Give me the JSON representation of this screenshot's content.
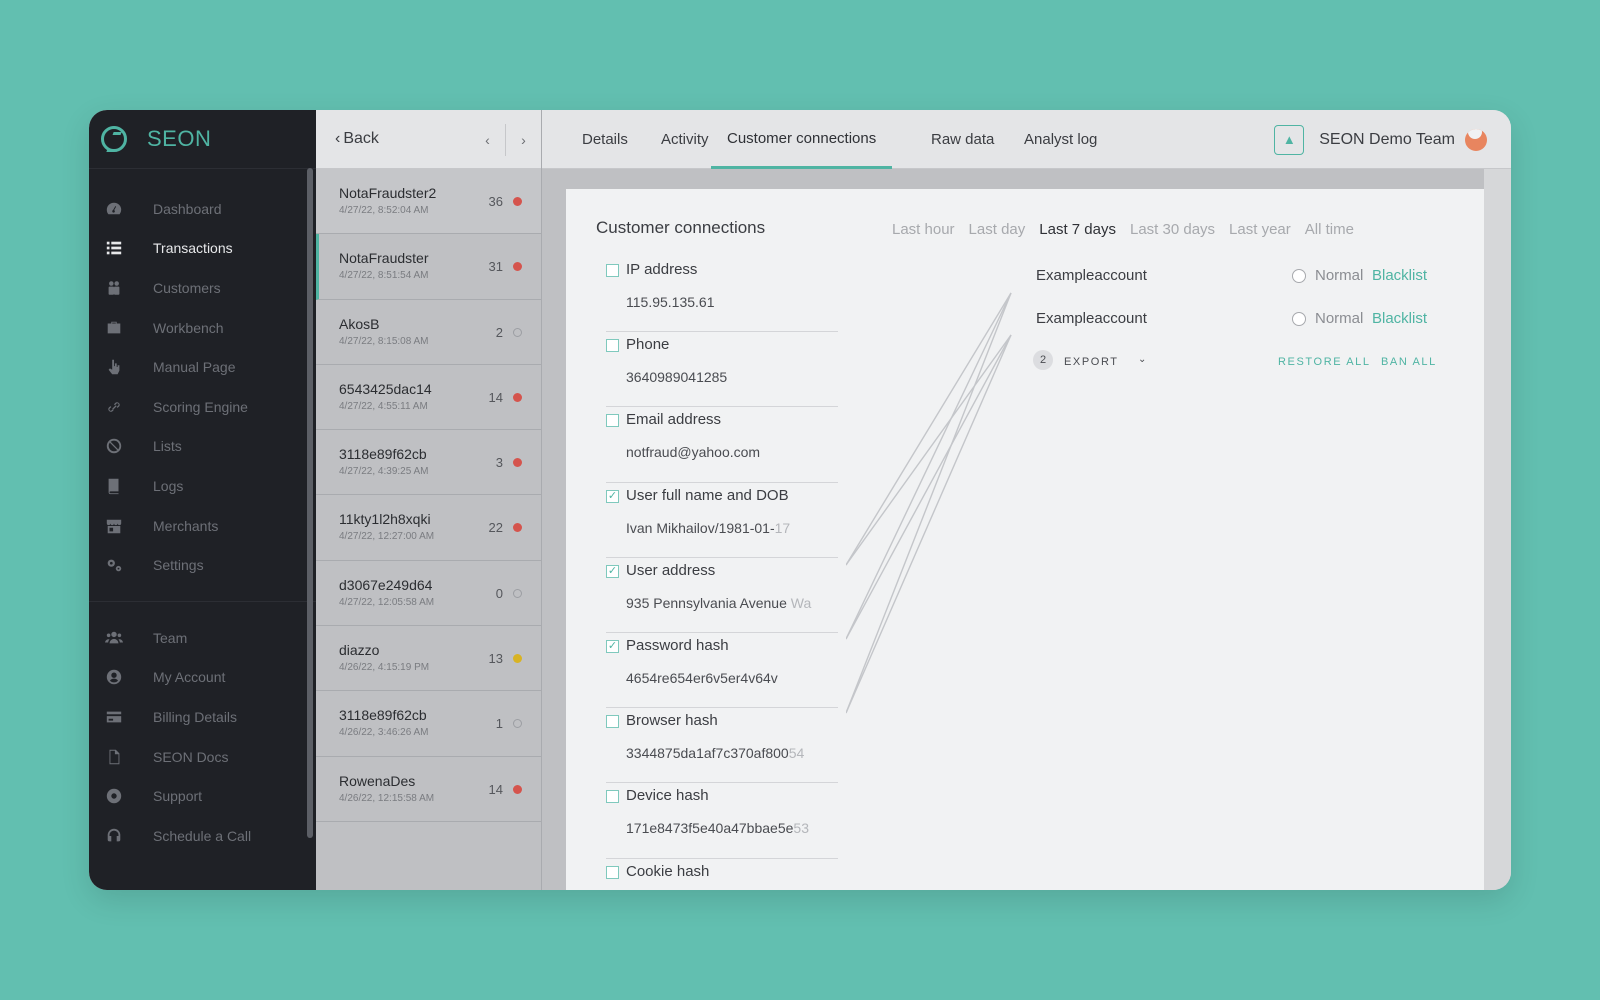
{
  "brand": {
    "name": "SEON"
  },
  "sidebar": {
    "items": [
      {
        "label": "Dashboard",
        "icon": "dashboard-icon",
        "active": false
      },
      {
        "label": "Transactions",
        "icon": "list-icon",
        "active": true
      },
      {
        "label": "Customers",
        "icon": "customers-icon",
        "active": false
      },
      {
        "label": "Workbench",
        "icon": "briefcase-icon",
        "active": false
      },
      {
        "label": "Manual Page",
        "icon": "hand-pointer-icon",
        "active": false
      },
      {
        "label": "Scoring Engine",
        "icon": "link-icon",
        "active": false
      },
      {
        "label": "Lists",
        "icon": "ban-icon",
        "active": false
      },
      {
        "label": "Logs",
        "icon": "book-icon",
        "active": false
      },
      {
        "label": "Merchants",
        "icon": "store-icon",
        "active": false
      },
      {
        "label": "Settings",
        "icon": "gears-icon",
        "active": false
      }
    ],
    "bottom_items": [
      {
        "label": "Team",
        "icon": "team-icon"
      },
      {
        "label": "My Account",
        "icon": "user-circle-icon"
      },
      {
        "label": "Billing Details",
        "icon": "credit-card-icon"
      },
      {
        "label": "SEON Docs",
        "icon": "document-icon"
      },
      {
        "label": "Support",
        "icon": "lifebuoy-icon"
      },
      {
        "label": "Schedule a Call",
        "icon": "headset-icon"
      }
    ]
  },
  "list_panel": {
    "back_label": "Back",
    "prev_icon": "‹",
    "next_icon": "›",
    "rows": [
      {
        "name": "NotaFraudster2",
        "date": "4/27/22, 8:52:04 AM",
        "score": "36",
        "status": "red"
      },
      {
        "name": "NotaFraudster",
        "date": "4/27/22, 8:51:54 AM",
        "score": "31",
        "status": "red"
      },
      {
        "name": "AkosB",
        "date": "4/27/22, 8:15:08 AM",
        "score": "2",
        "status": "empty"
      },
      {
        "name": "6543425dac14",
        "date": "4/27/22, 4:55:11 AM",
        "score": "14",
        "status": "red"
      },
      {
        "name": "3118e89f62cb",
        "date": "4/27/22, 4:39:25 AM",
        "score": "3",
        "status": "red"
      },
      {
        "name": "11kty1l2h8xqki",
        "date": "4/27/22, 12:27:00 AM",
        "score": "22",
        "status": "red"
      },
      {
        "name": "d3067e249d64",
        "date": "4/27/22, 12:05:58 AM",
        "score": "0",
        "status": "empty"
      },
      {
        "name": "diazzo",
        "date": "4/26/22, 4:15:19 PM",
        "score": "13",
        "status": "yellow"
      },
      {
        "name": "3118e89f62cb",
        "date": "4/26/22, 3:46:26 AM",
        "score": "1",
        "status": "empty"
      },
      {
        "name": "RowenaDes",
        "date": "4/26/22, 12:15:58 AM",
        "score": "14",
        "status": "red"
      }
    ]
  },
  "tabs": [
    "Details",
    "Activity",
    "Customer connections",
    "Raw data",
    "Analyst log"
  ],
  "active_tab": "Customer connections",
  "team": {
    "name": "SEON Demo Team",
    "badge_icon": "graduation-cap-icon"
  },
  "card": {
    "title": "Customer connections",
    "time_filters": [
      "Last hour",
      "Last day",
      "Last 7 days",
      "Last 30 days",
      "Last year",
      "All time"
    ],
    "active_filter": "Last 7 days",
    "connections": [
      {
        "label": "IP address",
        "value": "115.95.135.61",
        "value_fade": "",
        "checked": false
      },
      {
        "label": "Phone",
        "value": "3640989041285",
        "value_fade": "",
        "checked": false
      },
      {
        "label": "Email address",
        "value": "notfraud@yahoo.com",
        "value_fade": "",
        "checked": false
      },
      {
        "label": "User full name and DOB",
        "value": "Ivan Mikhailov/1981-01-",
        "value_fade": "17",
        "checked": true
      },
      {
        "label": "User address",
        "value": "935 Pennsylvania Avenue ",
        "value_fade": "Wa",
        "checked": true
      },
      {
        "label": "Password hash",
        "value": "4654re654er6v5er4v64v",
        "value_fade": "",
        "checked": true
      },
      {
        "label": "Browser hash",
        "value": "3344875da1af7c370af800",
        "value_fade": "54",
        "checked": false
      },
      {
        "label": "Device hash",
        "value": "171e8473f5e40a47bbae5e",
        "value_fade": "53",
        "checked": false
      },
      {
        "label": "Cookie hash",
        "value": "",
        "value_fade": "",
        "checked": false
      }
    ],
    "accounts": [
      {
        "name": "Exampleaccount",
        "normal_label": "Normal",
        "blacklist_label": "Blacklist"
      },
      {
        "name": "Exampleaccount",
        "normal_label": "Normal",
        "blacklist_label": "Blacklist"
      }
    ],
    "count": "2",
    "export_label": "EXPORT",
    "restore_label": "RESTORE ALL",
    "ban_label": "BAN ALL"
  }
}
